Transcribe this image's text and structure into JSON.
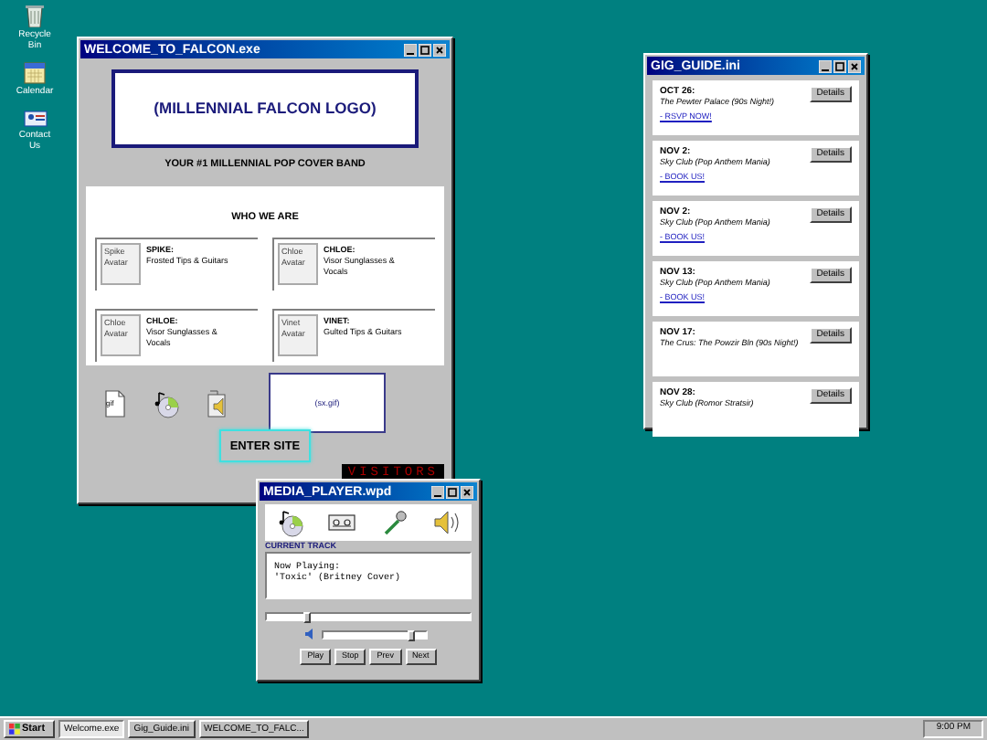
{
  "desktop_icons": [
    {
      "label": "Recycle Bin",
      "kind": "bin"
    },
    {
      "label": "Calendar",
      "kind": "calendar"
    },
    {
      "label": "Contact Us",
      "kind": "contact"
    }
  ],
  "welcome_window": {
    "title": "WELCOME_TO_FALCON.exe",
    "logo": "(MILLENNIAL FALCON LOGO)",
    "tagline": "YOUR #1 MILLENNIAL POP COVER BAND",
    "section_title": "WHO WE ARE",
    "members": [
      {
        "avatar_alt": "Spike Avatar",
        "name": "SPIKE:",
        "role": "Frosted Tips & Guitars"
      },
      {
        "avatar_alt": "Chloe Avatar",
        "name": "CHLOE:",
        "role": "Visor Sunglasses & Vocals"
      },
      {
        "avatar_alt": "Chloe Avatar",
        "name": "CHLOE:",
        "role": "Visor Sunglasses & Vocals"
      },
      {
        "avatar_alt": "Vinet Avatar",
        "name": "VINET:",
        "role": "Gulted Tips & Guitars"
      }
    ],
    "file_icons": [
      {
        "kind": "gif",
        "label": "gif"
      },
      {
        "kind": "cd"
      },
      {
        "kind": "sound"
      }
    ],
    "gif_placeholder": "(sx.gif)",
    "enter_button": "ENTER SITE",
    "visitor_counter": "VISITORS"
  },
  "gig_guide": {
    "title": "GIG_GUIDE.ini",
    "gigs": [
      {
        "date": "OCT 26:",
        "venue": "The Pewter Palace (90s Night!)",
        "link": "- RSVP NOW!",
        "details_button": "Details"
      },
      {
        "date": "NOV 2:",
        "venue": "Sky Club (Pop Anthem Mania)",
        "link": "- BOOK US!",
        "details_button": "Details"
      },
      {
        "date": "NOV 2:",
        "venue": "Sky Club (Pop Anthem Mania)",
        "link": "- BOOK US!",
        "details_button": "Details"
      },
      {
        "date": "NOV 13:",
        "venue": "Sky Club (Pop Anthem Mania)",
        "link": "- BOOK US!",
        "details_button": "Details"
      },
      {
        "date": "NOV 17:",
        "venue": "The Crus: The Powzir Bln (90s Night!)",
        "details_button": "Details"
      },
      {
        "date": "NOV 28:",
        "venue": "Sky Club (Romor Stratsir)",
        "details_button": "Details"
      }
    ]
  },
  "media_player": {
    "title": "MEDIA_PLAYER.wpd",
    "tools": [
      {
        "kind": "cd"
      },
      {
        "kind": "tape"
      },
      {
        "kind": "mic"
      },
      {
        "kind": "speaker"
      }
    ],
    "section_label": "CURRENT TRACK",
    "now_playing": [
      "Now Playing:",
      "'Toxic' (Britney Cover)"
    ],
    "seek": {
      "level": 0.2
    },
    "volume": {
      "level": 0.85
    },
    "buttons": [
      "Play",
      "Stop",
      "Prev",
      "Next"
    ]
  },
  "taskbar": {
    "start": "Start",
    "tasks": [
      {
        "label": "Welcome.exe",
        "selected": true
      },
      {
        "label": "Gig_Guide.ini",
        "selected": false
      },
      {
        "label": "WELCOME_TO_FALC...",
        "selected": false
      }
    ],
    "clock": "9:00 PM"
  }
}
